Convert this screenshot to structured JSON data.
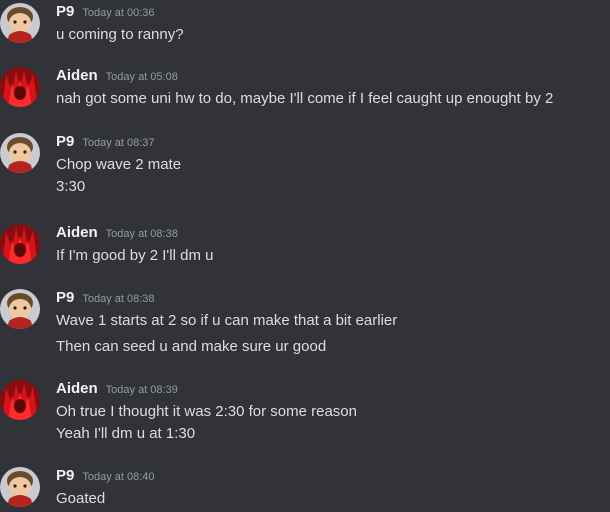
{
  "users": {
    "p9": {
      "name": "P9",
      "avatar_icon": "villager-avatar-icon"
    },
    "aiden": {
      "name": "Aiden",
      "avatar_icon": "red-hair-avatar-icon"
    }
  },
  "colors": {
    "background": "#313338",
    "username": "#f2f3f5",
    "timestamp": "#949ba4",
    "message_text": "#dbdee1"
  },
  "messages": [
    {
      "author": "P9",
      "time": "Today at 00:36",
      "lines": [
        "u coming to ranny?"
      ]
    },
    {
      "author": "Aiden",
      "time": "Today at 05:08",
      "lines": [
        "nah got some uni hw to do, maybe I'll come if I feel caught up enought by 2"
      ]
    },
    {
      "author": "P9",
      "time": "Today at 08:37",
      "lines": [
        "Chop wave 2 mate",
        "3:30"
      ]
    },
    {
      "author": "Aiden",
      "time": "Today at 08:38",
      "lines": [
        "If I'm good by 2 I'll dm u"
      ]
    },
    {
      "author": "P9",
      "time": "Today at 08:38",
      "lines": [
        "Wave 1 starts at 2 so if u can make that a bit earlier",
        "Then can seed u and make sure ur good"
      ]
    },
    {
      "author": "Aiden",
      "time": "Today at 08:39",
      "lines": [
        "Oh true I thought it was 2:30 for some reason",
        "Yeah I'll dm u at 1:30"
      ]
    },
    {
      "author": "P9",
      "time": "Today at 08:40",
      "lines": [
        "Goated"
      ]
    }
  ]
}
